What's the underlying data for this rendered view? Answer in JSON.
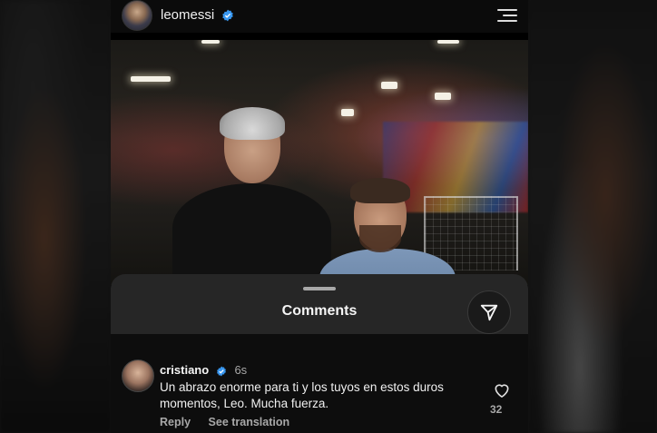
{
  "header": {
    "username": "leomessi",
    "verified_icon": "verified-badge-icon",
    "menu_icon": "hamburger-menu-icon"
  },
  "post": {
    "photo_description_icon": "photo"
  },
  "comments_sheet": {
    "title": "Comments",
    "share_icon": "send-icon"
  },
  "comment": {
    "username": "cristiano",
    "time": "6s",
    "text": "Un abrazo enorme para ti y los tuyos en estos duros momentos, Leo. Mucha fuerza.",
    "reply_label": "Reply",
    "translate_label": "See translation",
    "like_count": "32"
  },
  "colors": {
    "verified": "#3897f0",
    "sheet_bg": "#262626",
    "secondary_text": "#a8a8a8"
  }
}
